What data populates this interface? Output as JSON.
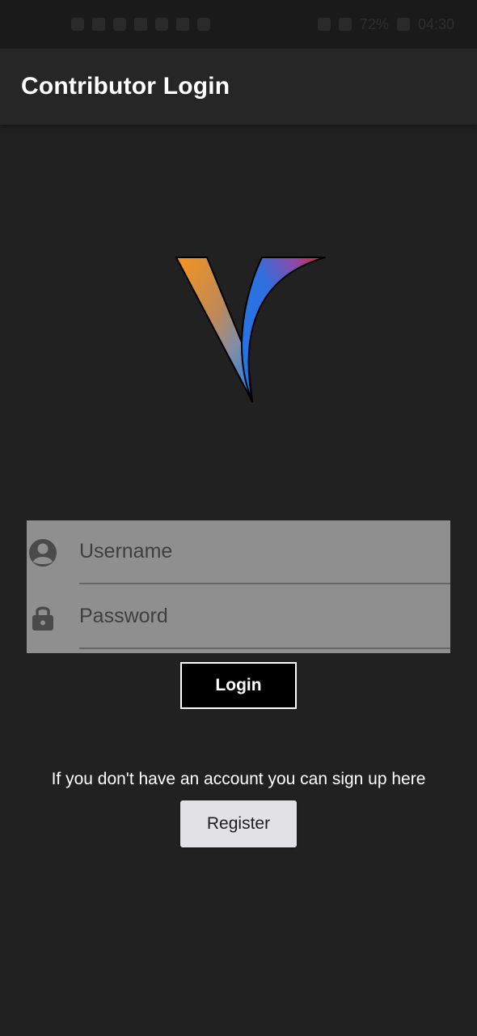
{
  "status_bar": {
    "time": "04:30",
    "battery": "72%"
  },
  "app_bar": {
    "title": "Contributor Login"
  },
  "logo": {
    "icon": "v-logo",
    "colors": {
      "orange": "#f7931e",
      "blue": "#1e78e6",
      "red": "#e8202a"
    }
  },
  "form": {
    "username": {
      "placeholder": "Username",
      "value": "",
      "icon": "account-circle-icon"
    },
    "password": {
      "placeholder": "Password",
      "value": "",
      "icon": "lock-icon"
    },
    "login_label": "Login"
  },
  "signup": {
    "hint": "If you don't have an account you can sign up here",
    "register_label": "Register"
  }
}
